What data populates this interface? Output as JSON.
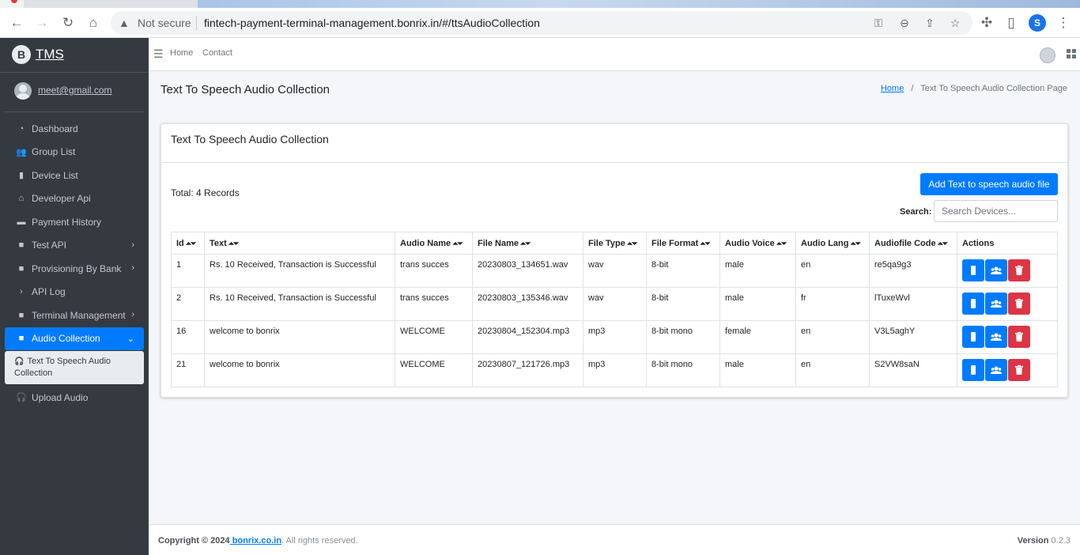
{
  "browser": {
    "security_label": "Not secure",
    "url": "fintech-payment-terminal-management.bonrix.in/#/ttsAudioCollection",
    "profile_initial": "S"
  },
  "sidebar": {
    "brand": "TMS",
    "brand_logo_letter": "B",
    "user_email": "meet@gmail.com",
    "items": [
      {
        "label": "Dashboard",
        "icon": "dashboard-icon"
      },
      {
        "label": "Group List",
        "icon": "users-icon"
      },
      {
        "label": "Device List",
        "icon": "mobile-icon"
      },
      {
        "label": "Developer Api",
        "icon": "inbox-icon"
      },
      {
        "label": "Payment History",
        "icon": "card-icon"
      },
      {
        "label": "Test API",
        "icon": "folder-icon"
      },
      {
        "label": "Provisioning By Bank",
        "icon": "folder-icon"
      },
      {
        "label": "API Log",
        "icon": "chevron-right-icon"
      },
      {
        "label": "Terminal Management",
        "icon": "folder-icon"
      },
      {
        "label": "Audio Collection",
        "icon": "folder-icon"
      }
    ],
    "sub_item": "Text To Speech Audio Collection",
    "upload_audio": "Upload Audio"
  },
  "header": {
    "home": "Home",
    "contact": "Contact"
  },
  "page": {
    "title": "Text To Speech Audio Collection",
    "breadcrumb_home": "Home",
    "breadcrumb_sep": "/",
    "breadcrumb_current": "Text To Speech Audio Collection Page"
  },
  "card": {
    "title": "Text To Speech Audio Collection",
    "total": "Total: 4 Records",
    "add_button": "Add Text to speech audio file",
    "search_label": "Search:",
    "search_placeholder": "Search Devices..."
  },
  "table": {
    "columns": [
      "Id",
      "Text",
      "Audio Name",
      "File Name",
      "File Type",
      "File Format",
      "Audio Voice",
      "Audio Lang",
      "Audiofile Code",
      "Actions"
    ],
    "rows": [
      [
        "1",
        "Rs. 10 Received, Transaction is Successful",
        "trans succes",
        "20230803_134651.wav",
        "wav",
        "8-bit",
        "male",
        "en",
        "re5qa9g3"
      ],
      [
        "2",
        "Rs. 10 Received, Transaction is Successful",
        "trans succes",
        "20230803_135346.wav",
        "wav",
        "8-bit",
        "male",
        "fr",
        "lTuxeWvl"
      ],
      [
        "16",
        "welcome to bonrix",
        "WELCOME",
        "20230804_152304.mp3",
        "mp3",
        "8-bit mono",
        "female",
        "en",
        "V3L5aghY"
      ],
      [
        "21",
        "welcome to bonrix",
        "WELCOME",
        "20230807_121726.mp3",
        "mp3",
        "8-bit mono",
        "male",
        "en",
        "S2VW8saN"
      ]
    ]
  },
  "footer": {
    "copyright_prefix": "Copyright © 2024",
    "copyright_link": " bonrix.co.in",
    "copyright_suffix": ". All rights reserved.",
    "version_label": "Version",
    "version": "0.2.3"
  },
  "colors": {
    "primary": "#007bff",
    "danger": "#dc3545",
    "sidebar": "#343a40"
  }
}
